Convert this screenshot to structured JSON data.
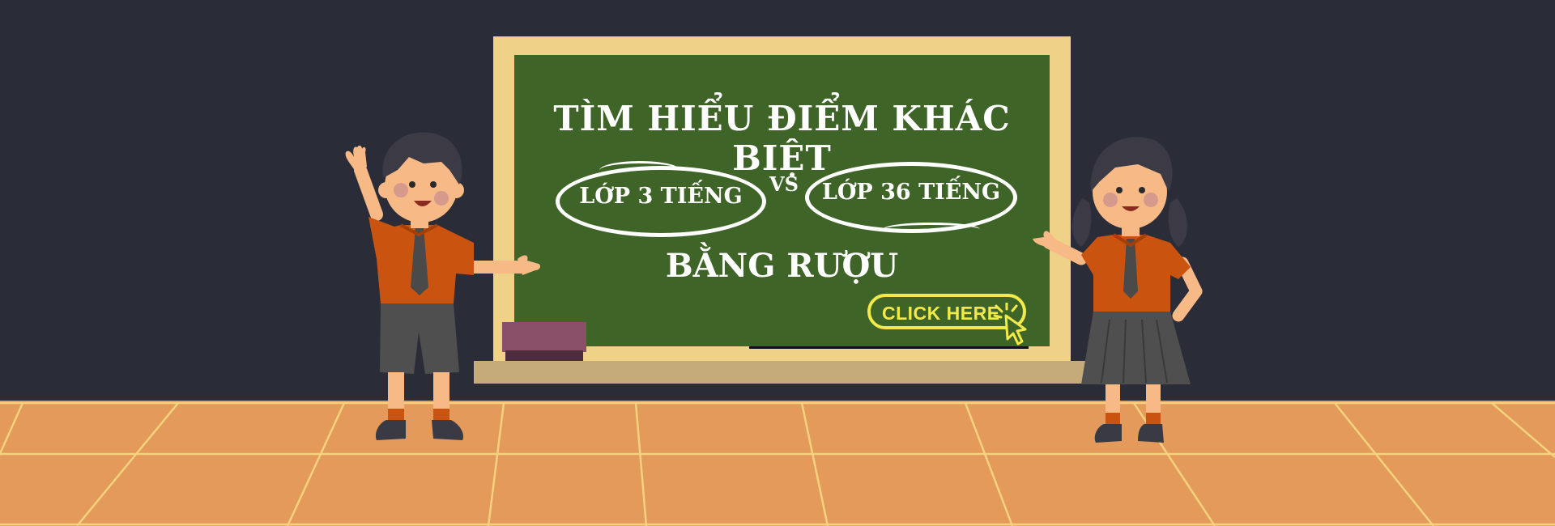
{
  "board": {
    "headline": "TÌM HIỂU ĐIỂM KHÁC BIỆT",
    "option_left": "LỚP 3 TIẾNG",
    "vs_label": "VS",
    "option_right": "LỚP 36 TIẾNG",
    "subline": "BẰNG RƯỢU"
  },
  "cta": {
    "label": "CLICK HERE",
    "icon": "cursor-click-icon"
  },
  "colors": {
    "wall": "#2a2d38",
    "floor": "#e39a5b",
    "floor_lines": "#f5d27e",
    "board": "#3f6428",
    "board_frame": "#efd187",
    "cta": "#f3ea4a",
    "uniform_shirt": "#c9530f",
    "uniform_bottom": "#4f4f4f"
  },
  "illustrations": {
    "boy": "student-boy-waving",
    "girl": "student-girl-presenting",
    "eraser": "board-eraser"
  }
}
